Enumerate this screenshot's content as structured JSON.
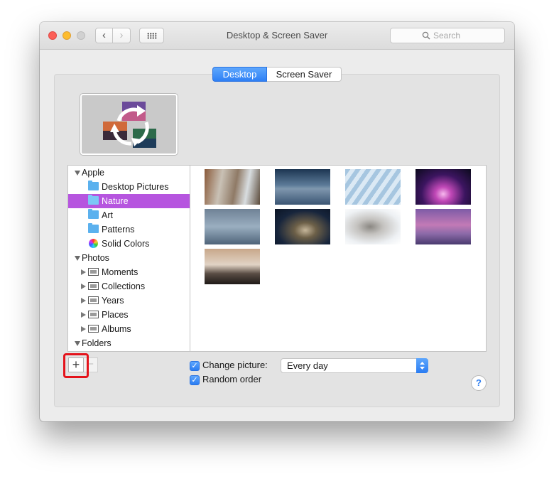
{
  "window": {
    "title": "Desktop & Screen Saver",
    "search_placeholder": "Search"
  },
  "tabs": [
    {
      "label": "Desktop",
      "selected": true
    },
    {
      "label": "Screen Saver",
      "selected": false
    }
  ],
  "sources": {
    "apple": "Apple",
    "desktop_pictures": "Desktop Pictures",
    "nature": "Nature",
    "art": "Art",
    "patterns": "Patterns",
    "solid_colors": "Solid Colors",
    "photos": "Photos",
    "moments": "Moments",
    "collections": "Collections",
    "years": "Years",
    "places": "Places",
    "albums": "Albums",
    "folders": "Folders",
    "selected": "Nature"
  },
  "controls": {
    "add_label": "+",
    "remove_label": "−",
    "change_picture_label": "Change picture:",
    "change_picture_checked": true,
    "interval_value": "Every day",
    "random_order_label": "Random order",
    "random_order_checked": true,
    "help_label": "?"
  },
  "colors": {
    "accent": "#2e80f5",
    "selection": "#b655df",
    "highlight": "#e4131b"
  }
}
